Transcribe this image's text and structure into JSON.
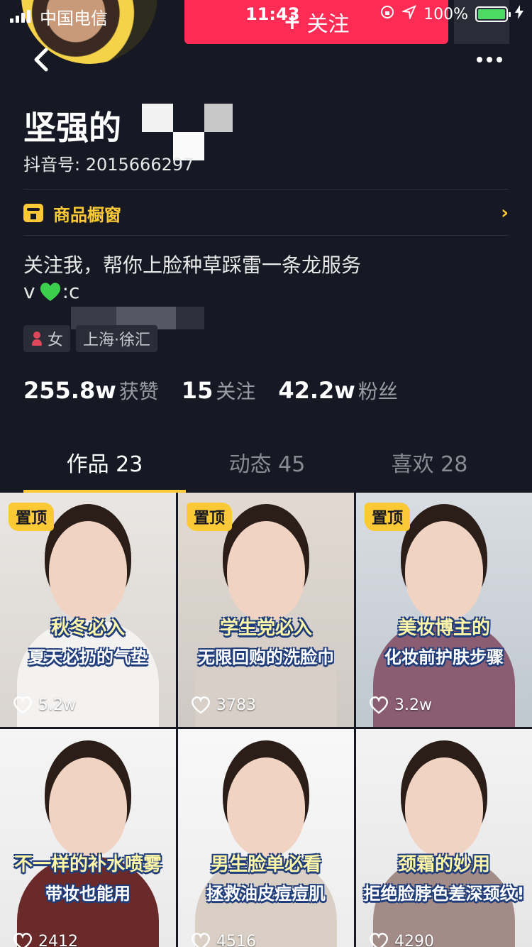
{
  "status_bar": {
    "carrier": "中国电信",
    "time": "11:43",
    "battery": "100%"
  },
  "header": {
    "follow_label": "关注",
    "follow_plus": "+"
  },
  "profile": {
    "nickname": "坚强的",
    "douyin_id": "抖音号: 2015666297",
    "showcase_label": "商品橱窗",
    "showcase_chevron": "›",
    "bio_line1": "关注我，帮你上脸种草踩雷一条龙服务",
    "bio_line2_prefix": "v",
    "bio_line2_after": ":c",
    "tags": [
      {
        "label": "女"
      },
      {
        "label": "上海·徐汇"
      }
    ],
    "stats": [
      {
        "num": "255.8w",
        "label": "获赞"
      },
      {
        "num": "15",
        "label": "关注"
      },
      {
        "num": "42.2w",
        "label": "粉丝"
      }
    ]
  },
  "tabs": [
    {
      "label": "作品 23"
    },
    {
      "label": "动态 45"
    },
    {
      "label": "喜欢 28"
    }
  ],
  "videos": [
    {
      "pinned": "置顶",
      "caption1": "秋冬必入",
      "caption2": "夏天必扔的气垫",
      "likes": "5.2w",
      "bg": "#d9d4cf",
      "top": "#e9e6e3",
      "cloth": "#f4f2f0"
    },
    {
      "pinned": "置顶",
      "caption1": "学生党必入",
      "caption2": "无限回购的洗脸巾",
      "likes": "3783",
      "bg": "#cfc9c4",
      "top": "#e2dad2",
      "cloth": "#d8d0c8"
    },
    {
      "pinned": "置顶",
      "caption1": "美妆博主的",
      "caption2": "化妆前护肤步骤",
      "likes": "3.2w",
      "bg": "#bfc7cf",
      "top": "#d8dde2",
      "cloth": "#8a5d73"
    },
    {
      "pinned": "",
      "caption1": "不一样的补水喷雾",
      "caption2": "带妆也能用",
      "likes": "2412",
      "bg": "#e8e8e8",
      "top": "#f5f5f5",
      "cloth": "#6b2a2a"
    },
    {
      "pinned": "",
      "caption1": "男生脸单必看",
      "caption2": "拯救油皮痘痘肌",
      "likes": "4516",
      "bg": "#ececec",
      "top": "#f8f8f8",
      "cloth": "#d9cfc4"
    },
    {
      "pinned": "",
      "caption1": "颈霜的妙用",
      "caption2": "拒绝脸脖色差深颈纹!",
      "likes": "4290",
      "bg": "#e4e4e4",
      "top": "#f3f3f3",
      "cloth": "#a38b88"
    }
  ],
  "colors": {
    "background": "#161823",
    "accent_red": "#fe2c55",
    "accent_yellow": "#fbc935"
  }
}
